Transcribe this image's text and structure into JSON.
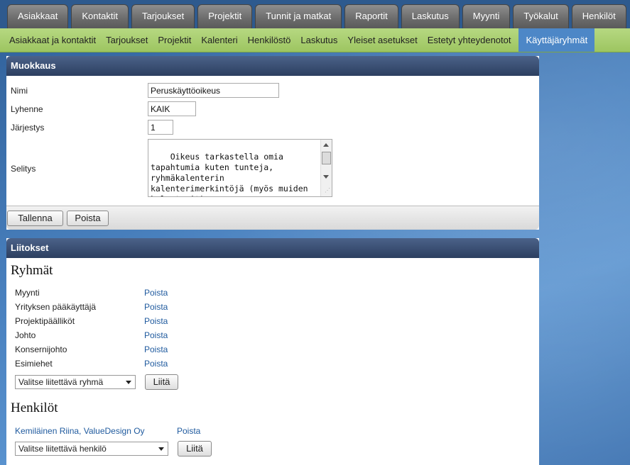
{
  "top_tabs": [
    "Asiakkaat",
    "Kontaktit",
    "Tarjoukset",
    "Projektit",
    "Tunnit ja matkat",
    "Raportit",
    "Laskutus",
    "Myynti",
    "Työkalut",
    "Henkilöt"
  ],
  "sub_tabs": [
    "Asiakkaat ja kontaktit",
    "Tarjoukset",
    "Projektit",
    "Kalenteri",
    "Henkilöstö",
    "Laskutus",
    "Yleiset asetukset",
    "Estetyt yhteydenotot",
    "Käyttäjäryhmät"
  ],
  "edit_panel": {
    "title": "Muokkaus",
    "name_label": "Nimi",
    "name_value": "Peruskäyttöoikeus",
    "abbr_label": "Lyhenne",
    "abbr_value": "KAIK",
    "order_label": "Järjestys",
    "order_value": "1",
    "desc_label": "Selitys",
    "desc_value": "Oikeus tarkastella omia tapahtumia kuten tunteja, ryhmäkalenterin kalenterimerkintöjä (myös muiden kalenterit),",
    "save_label": "Tallenna",
    "delete_label": "Poista"
  },
  "links_panel": {
    "title": "Liitokset",
    "groups_title": "Ryhmät",
    "groups": [
      {
        "name": "Myynti",
        "remove": "Poista"
      },
      {
        "name": "Yrityksen pääkäyttäjä",
        "remove": "Poista"
      },
      {
        "name": "Projektipäälliköt",
        "remove": "Poista"
      },
      {
        "name": "Johto",
        "remove": "Poista"
      },
      {
        "name": "Konsernijohto",
        "remove": "Poista"
      },
      {
        "name": "Esimiehet",
        "remove": "Poista"
      }
    ],
    "group_select": "Valitse liitettävä ryhmä",
    "group_attach": "Liitä",
    "persons_title": "Henkilöt",
    "person_name": "Kemiläinen Riina, ValueDesign Oy",
    "person_remove": "Poista",
    "person_select": "Valitse liitettävä henkilö",
    "person_attach": "Liitä"
  }
}
